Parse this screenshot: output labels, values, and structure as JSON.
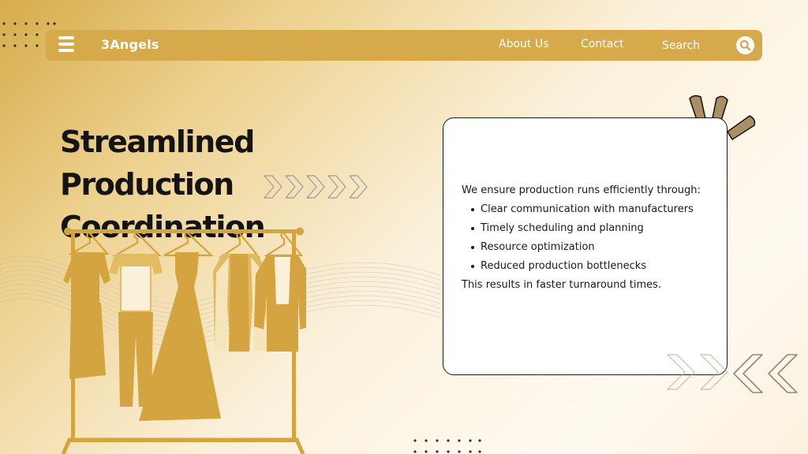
{
  "nav": {
    "brand": "3Angels",
    "links": [
      "About Us",
      "Contact",
      "Search"
    ],
    "menu_icon": "hamburger-menu-icon",
    "search_icon": "search-icon"
  },
  "hero": {
    "title_line1": "Streamlined Production",
    "title_line2": "Coordination"
  },
  "card": {
    "intro": "We ensure production runs efficiently through:",
    "bullets": [
      "Clear communication with manufacturers",
      "Timely scheduling and planning",
      "Resource optimization",
      "Reduced production bottlenecks"
    ],
    "outro": "This results in faster turnaround times."
  },
  "illustration": "clothing-rack-illustration",
  "colors": {
    "accent": "#d6a94a",
    "garment": "#d4a441",
    "text": "#141414",
    "card_bg": "#ffffff",
    "burst": "#a98f63"
  }
}
